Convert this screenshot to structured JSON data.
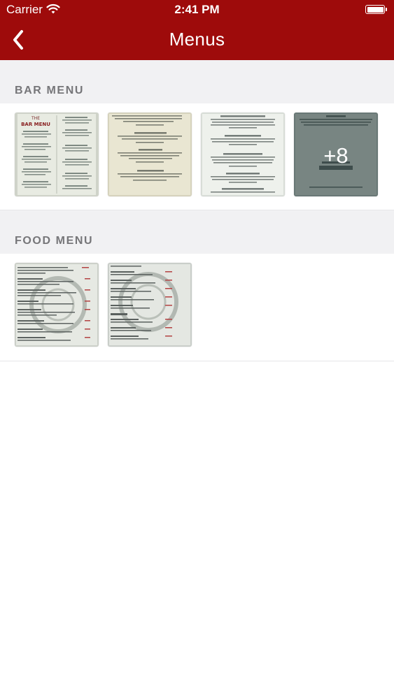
{
  "status_bar": {
    "carrier": "Carrier",
    "time": "2:41 PM",
    "battery_level": 1.0
  },
  "nav": {
    "title": "Menus",
    "back_icon": "chevron-left-icon"
  },
  "sections": [
    {
      "label": "BAR MENU",
      "items": [
        {
          "name": "bar-menu-page-1"
        },
        {
          "name": "bar-menu-page-2"
        },
        {
          "name": "bar-menu-page-3"
        },
        {
          "name": "bar-menu-page-4",
          "more_label": "+8"
        }
      ]
    },
    {
      "label": "FOOD MENU",
      "items": [
        {
          "name": "food-menu-page-1"
        },
        {
          "name": "food-menu-page-2"
        }
      ]
    }
  ],
  "colors": {
    "brand": "#9e0b0b",
    "section_header_bg": "#f1f1f3",
    "section_label": "#767679"
  }
}
